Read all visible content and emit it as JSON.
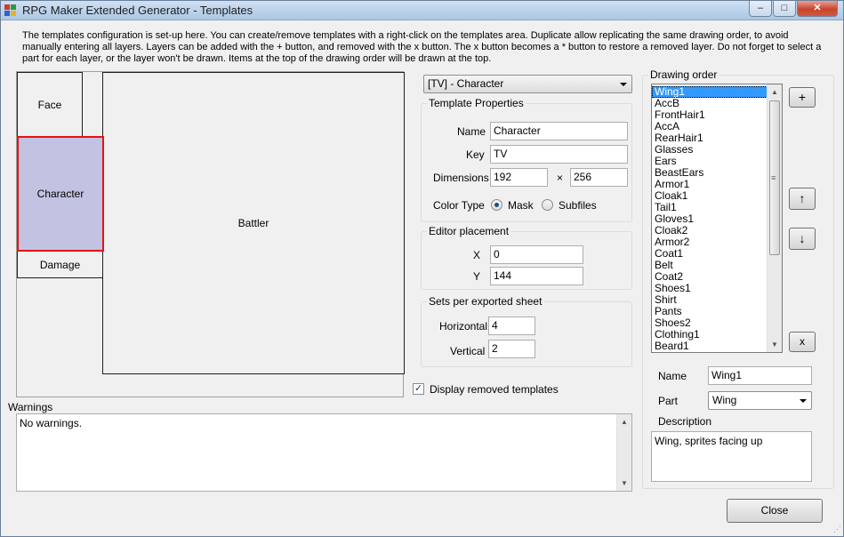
{
  "window": {
    "title": "RPG Maker Extended Generator - Templates",
    "controls": {
      "minimize": "–",
      "maximize": "□",
      "close": "✕"
    }
  },
  "intro_text": "The templates configuration is set-up here. You can create/remove templates with a right-click on the templates area. Duplicate allow replicating the same drawing order, to avoid manually entering all layers. Layers can be added with the + button, and removed with the x button. The x button becomes a * button to restore a removed layer. Do not forget to select a part for each layer, or the layer won't be drawn. Items at the top of the drawing order will be drawn at the top.",
  "canvas": {
    "regions": {
      "face": "Face",
      "character": "Character",
      "damage": "Damage",
      "battler": "Battler"
    }
  },
  "template_select": {
    "value": "[TV] - Character"
  },
  "template_properties": {
    "title": "Template Properties",
    "name_label": "Name",
    "name_value": "Character",
    "key_label": "Key",
    "key_value": "TV",
    "dimensions_label": "Dimensions",
    "width_value": "192",
    "times": "×",
    "height_value": "256",
    "color_type_label": "Color Type",
    "mask_label": "Mask",
    "subfiles_label": "Subfiles",
    "color_type_selected": "Mask"
  },
  "editor_placement": {
    "title": "Editor placement",
    "x_label": "X",
    "x_value": "0",
    "y_label": "Y",
    "y_value": "144"
  },
  "sets_per_sheet": {
    "title": "Sets per exported sheet",
    "horizontal_label": "Horizontal",
    "horizontal_value": "4",
    "vertical_label": "Vertical",
    "vertical_value": "2"
  },
  "display_removed": {
    "label": "Display removed templates",
    "checked": true,
    "mark": "✓"
  },
  "warnings": {
    "label": "Warnings",
    "text": "No warnings."
  },
  "drawing_order": {
    "title": "Drawing order",
    "items": [
      "Wing1",
      "AccB",
      "FrontHair1",
      "AccA",
      "RearHair1",
      "Glasses",
      "Ears",
      "BeastEars",
      "Armor1",
      "Cloak1",
      "Tail1",
      "Gloves1",
      "Cloak2",
      "Armor2",
      "Coat1",
      "Belt",
      "Coat2",
      "Shoes1",
      "Shirt",
      "Pants",
      "Shoes2",
      "Clothing1",
      "Beard1"
    ],
    "selected_index": 0,
    "add_button": "+",
    "up_button": "↑",
    "down_button": "↓",
    "remove_button": "x"
  },
  "layer": {
    "name_label": "Name",
    "name_value": "Wing1",
    "part_label": "Part",
    "part_value": "Wing",
    "description_label": "Description",
    "description_value": "Wing, sprites facing up"
  },
  "close_button": "Close",
  "icons": {
    "app": "app-icon",
    "dropdown": "chevron-down-icon",
    "scroll_up": "scroll-up-icon",
    "scroll_down": "scroll-down-icon",
    "grip": "grip-icon"
  },
  "colors": {
    "selected_region_fill": "#c2c2e2",
    "selected_region_border": "#e81010",
    "list_selection": "#3399ff"
  }
}
